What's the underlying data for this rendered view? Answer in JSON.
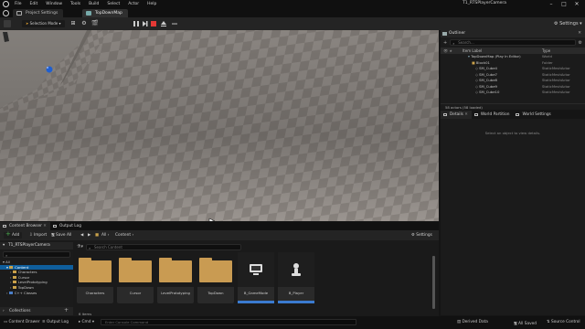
{
  "menu": [
    "File",
    "Edit",
    "Window",
    "Tools",
    "Build",
    "Select",
    "Actor",
    "Help"
  ],
  "window": {
    "title": "T1_RTSPlayerCamera"
  },
  "tabs": {
    "project_settings": "Project Settings",
    "map": "TopDownMap"
  },
  "toolbar": {
    "selection_mode": "Selection Mode",
    "settings": "Settings"
  },
  "outliner": {
    "tab": "Outliner",
    "search_placeholder": "Search...",
    "col_label": "Item Label",
    "col_type": "Type",
    "rows": [
      {
        "label": "TopDownMap (Play In Editor)",
        "type": "World"
      },
      {
        "label": "Block01",
        "type": "Folder"
      },
      {
        "label": "SM_Cube4",
        "type": "StaticMeshActor"
      },
      {
        "label": "SM_Cube7",
        "type": "StaticMeshActor"
      },
      {
        "label": "SM_Cube8",
        "type": "StaticMeshActor"
      },
      {
        "label": "SM_Cube9",
        "type": "StaticMeshActor"
      },
      {
        "label": "SM_Cube10",
        "type": "StaticMeshActor"
      }
    ],
    "footer": "58 actors (58 loaded)"
  },
  "details": {
    "tabs": [
      "Details",
      "World Partition",
      "World Settings"
    ],
    "message": "Select an object to view details."
  },
  "bottom_tabs": {
    "content_browser": "Content Browser",
    "output_log": "Output Log"
  },
  "content_browser": {
    "add": "Add",
    "import": "Import",
    "save_all": "Save All",
    "path": [
      "All",
      "Content"
    ],
    "settings": "Settings",
    "tree_header": "T1_RTSPlayerCamera",
    "tree": [
      "All",
      "Content",
      "Characters",
      "Cursor",
      "LevelPrototyping",
      "TopDown",
      "C++ Classes"
    ],
    "search_placeholder": "Search Content",
    "assets": [
      {
        "label": "Characters",
        "kind": "folder"
      },
      {
        "label": "Cursor",
        "kind": "folder"
      },
      {
        "label": "LevelPrototyping",
        "kind": "folder"
      },
      {
        "label": "TopDown",
        "kind": "folder"
      },
      {
        "label": "B_GameMode",
        "kind": "blueprint"
      },
      {
        "label": "B_Player",
        "kind": "blueprint"
      }
    ],
    "item_count": "6 items",
    "collections": "Collections"
  },
  "statusbar": {
    "content_drawer": "Content Drawer",
    "output_log": "Output Log",
    "cmd": "Cmd",
    "cmd_placeholder": "Enter Console Command",
    "derived_data": "Derived Data",
    "all_saved": "All Saved",
    "source_control": "Source Control"
  }
}
